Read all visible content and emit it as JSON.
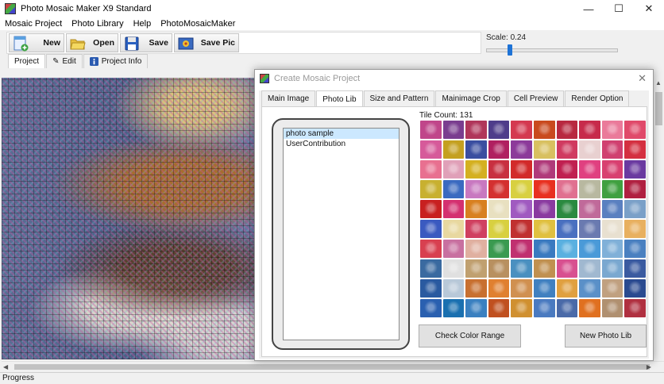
{
  "window": {
    "title": "Photo Mosaic Maker X9 Standard",
    "minimize": "—",
    "maximize": "☐",
    "close": "✕"
  },
  "menu": [
    "Mosaic Project",
    "Photo Library",
    "Help",
    "PhotoMosaicMaker"
  ],
  "toolbar": {
    "new_label": "New",
    "open_label": "Open",
    "save_label": "Save",
    "save_pic_label": "Save Pic"
  },
  "scale": {
    "label": "Scale: 0.24",
    "value": 0.24,
    "slider_fraction": 0.16
  },
  "main_tabs": [
    {
      "label": "Project",
      "icon": "none",
      "active": true
    },
    {
      "label": "Edit",
      "icon": "pencil-icon"
    },
    {
      "label": "Project Info",
      "icon": "info-icon"
    }
  ],
  "status": {
    "text": "Progress"
  },
  "dialog": {
    "title": "Create Mosaic Project",
    "close": "✕",
    "tabs": [
      "Main Image",
      "Photo Lib",
      "Size and Pattern",
      "Mainimage Crop",
      "Cell Preview",
      "Render Option"
    ],
    "active_tab": 1,
    "libraries": [
      "photo sample",
      "UserContribution"
    ],
    "selected_library": 0,
    "tile_count_label": "Tile Count: 131",
    "check_color_range": "Check Color Range",
    "new_photo_lib": "New Photo Lib"
  },
  "colors": {
    "accent": "#1e73d6",
    "selection": "#cce8ff",
    "tiles": [
      "#c0468a",
      "#7a3d8f",
      "#b0365a",
      "#4e3d8a",
      "#d43950",
      "#c94a1e",
      "#b82840",
      "#c72a4b",
      "#ea7a9a",
      "#e04a6a",
      "#d65a9a",
      "#c4a020",
      "#3a4ea0",
      "#b02060",
      "#8c3a9a",
      "#d8c060",
      "#d03a60",
      "#e8d0d0",
      "#d04070",
      "#d43040",
      "#e87090",
      "#e0a0b8",
      "#d4b020",
      "#c83040",
      "#d22a2a",
      "#b03a7a",
      "#c02050",
      "#e04080",
      "#d84070",
      "#6a3aa0",
      "#c8b030",
      "#3a6ac0",
      "#c878c0",
      "#d43030",
      "#d8d040",
      "#e83020",
      "#e07090",
      "#b8b8a0",
      "#40a040",
      "#b02040",
      "#c82020",
      "#d43070",
      "#d88020",
      "#e8e0c0",
      "#a05ac0",
      "#8a3aa0",
      "#2a8a40",
      "#c06a9a",
      "#5a80c0",
      "#7aa0c8",
      "#3a5ac0",
      "#e8d8a0",
      "#d04060",
      "#d8d040",
      "#c03030",
      "#e0c040",
      "#4a70c0",
      "#6a7ab0",
      "#e8e0d0",
      "#e8b060",
      "#d84050",
      "#c870a0",
      "#e0b0a0",
      "#3a9a50",
      "#c03070",
      "#3a7ac0",
      "#5ab0e0",
      "#4a9ad8",
      "#80b0d8",
      "#4a80c0",
      "#3a6aa0",
      "#e0e0e0",
      "#c0a070",
      "#b89060",
      "#4a90c0",
      "#c09050",
      "#d85090",
      "#a0b8d0",
      "#7aa8d0",
      "#3a5aa0",
      "#2a5aa0",
      "#b8c8d8",
      "#c87030",
      "#e08030",
      "#d09050",
      "#4080c0",
      "#e0a040",
      "#5a90c8",
      "#c0a080",
      "#2a4a90",
      "#2a60b0",
      "#1a70b0",
      "#3a80c0",
      "#c05020",
      "#d09030",
      "#4a7ac0",
      "#4a6aa8",
      "#e07020",
      "#b09070",
      "#b03040"
    ]
  }
}
